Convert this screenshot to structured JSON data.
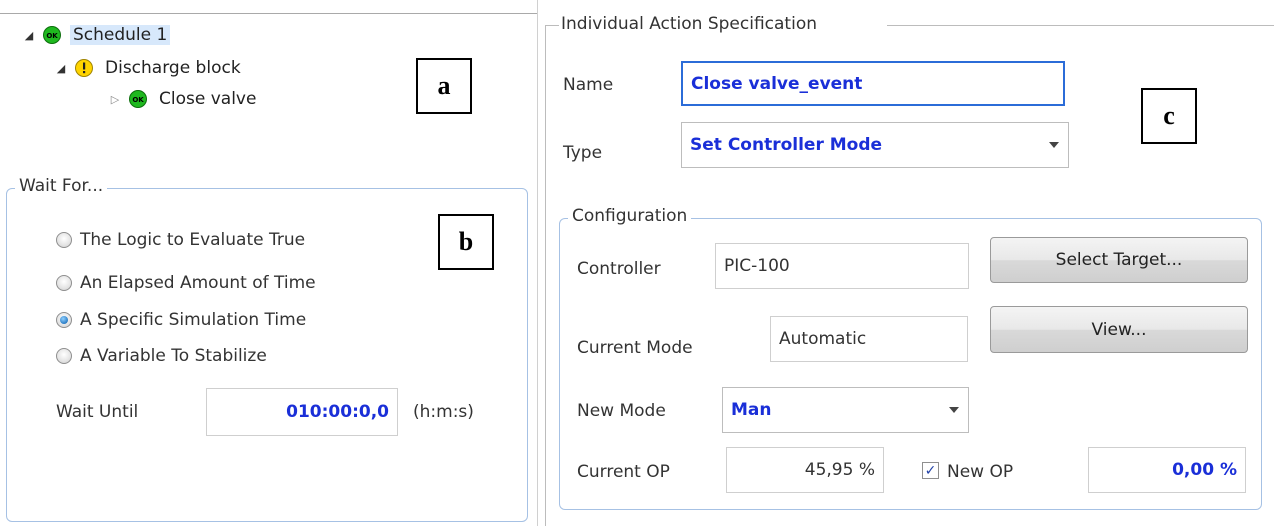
{
  "tree": {
    "items": [
      {
        "label": "Schedule 1",
        "status": "ok",
        "expander": "open"
      },
      {
        "label": "Discharge block",
        "status": "warning",
        "expander": "open"
      },
      {
        "label": "Close valve",
        "status": "ok",
        "expander": "closed"
      }
    ],
    "ok_badge": "OK"
  },
  "letters": {
    "a": "a",
    "b": "b",
    "c": "c"
  },
  "wait_for": {
    "title": "Wait For...",
    "options": [
      {
        "label": "The Logic to Evaluate True",
        "checked": false
      },
      {
        "label": "An Elapsed Amount of Time",
        "checked": false
      },
      {
        "label": "A Specific Simulation Time",
        "checked": true
      },
      {
        "label": "A Variable To Stabilize",
        "checked": false
      }
    ],
    "wait_until_label": "Wait Until",
    "wait_until_value": "010:00:0,0",
    "wait_until_unit": "(h:m:s)"
  },
  "action_spec": {
    "title": "Individual Action Specification",
    "name_label": "Name",
    "name_value": "Close valve_event",
    "type_label": "Type",
    "type_value": "Set Controller Mode",
    "configuration": {
      "title": "Configuration",
      "controller_label": "Controller",
      "controller_value": "PIC-100",
      "select_target_button": "Select Target...",
      "current_mode_label": "Current Mode",
      "current_mode_value": "Automatic",
      "view_button": "View...",
      "new_mode_label": "New Mode",
      "new_mode_value": "Man",
      "current_op_label": "Current OP",
      "current_op_value": "45,95 %",
      "new_op_label": "New OP",
      "new_op_checked": true,
      "new_op_value": "0,00 %"
    }
  },
  "colors": {
    "accent_blue_text": "#1a2fd8",
    "group_border": "#a6c1e4",
    "ok_green": "#1fb81f",
    "warning_yellow": "#ffd400",
    "selection": "#d7e8fb"
  }
}
